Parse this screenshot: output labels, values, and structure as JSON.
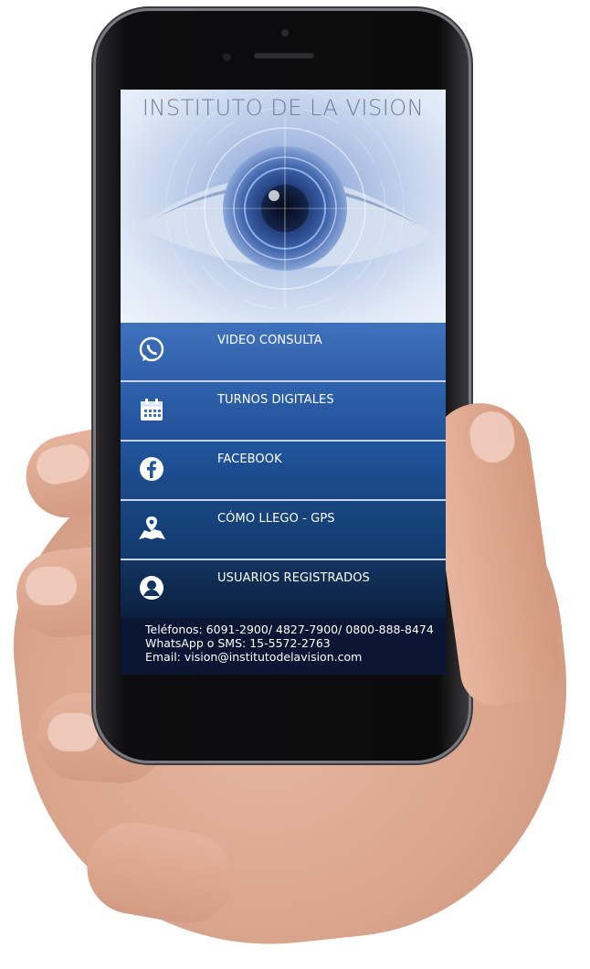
{
  "app": {
    "title": "INSTITUTO DE LA VISION"
  },
  "menu": {
    "items": [
      {
        "label": "VIDEO CONSULTA",
        "icon": "whatsapp-icon"
      },
      {
        "label": "TURNOS DIGITALES",
        "icon": "calendar-icon"
      },
      {
        "label": "FACEBOOK",
        "icon": "facebook-icon"
      },
      {
        "label": "CÓMO LLEGO - GPS",
        "icon": "map-pin-icon"
      },
      {
        "label": "USUARIOS REGISTRADOS",
        "icon": "user-icon"
      }
    ]
  },
  "contact": {
    "phones": "Teléfonos: 6091-2900/ 4827-7900/ 0800-888-8474",
    "whatsapp": "WhatsApp o SMS: 15-5572-2763",
    "email": "Email: vision@institutodelavision.com"
  },
  "colors": {
    "menu_blue": "#3f72bd",
    "menu_dark": "#0b2040",
    "footer": "#0a1634",
    "title_gray": "#6b7f99"
  }
}
